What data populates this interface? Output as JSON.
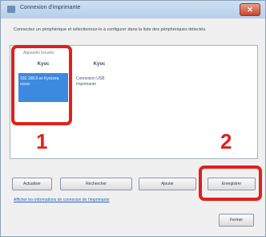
{
  "window": {
    "title": "Connexion d'imprimante",
    "close_label": "✕"
  },
  "instruction": "Connectez un périphérique et sélectionnez-le à configurer dans la liste des périphériques détectés.",
  "devices_panel": {
    "group_header": "Appareils trouvés",
    "devices": [
      {
        "name": "Kyoc",
        "detail": "192.168.0.xx  Kyocera xxxxx",
        "selected": true
      },
      {
        "name": "Kyoc",
        "detail": "Connexion USB  Imprimante",
        "selected": false
      }
    ]
  },
  "callouts": {
    "first": "1",
    "second": "2"
  },
  "buttons": {
    "b1": "Actualiser",
    "b2": "Rechercher",
    "b3": "Ajouter",
    "b4": "Enregistrer"
  },
  "link": "Afficher les informations de connexion de l'imprimante",
  "bottom_button": "Fermer"
}
